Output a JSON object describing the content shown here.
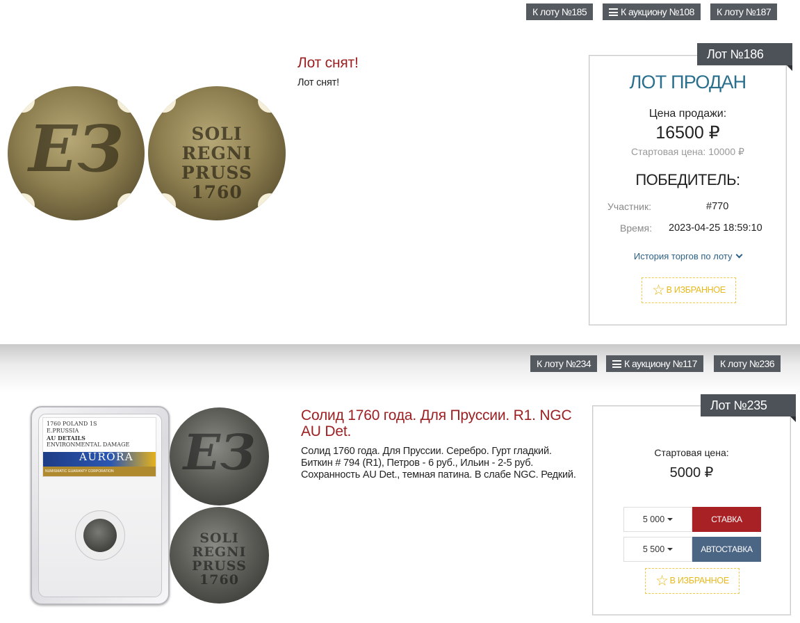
{
  "lot1": {
    "nav": {
      "prev": "К лоту №185",
      "auction": "К аукциону №108",
      "next": "К лоту №187"
    },
    "title": "Лот снят!",
    "description": "Лот снят!",
    "panel": {
      "lot_number": "Лот №186",
      "status": "ЛОТ ПРОДАН",
      "sale_price_label": "Цена продажи:",
      "sale_price": "16500 ₽",
      "start_price": "Стартовая цена: 10000 ₽",
      "winner_heading": "ПОБЕДИТЕЛЬ:",
      "participant_label": "Участник:",
      "participant_value": "#770",
      "time_label": "Время:",
      "time_value": "2023-04-25 18:59:10",
      "history_link": "История торгов по лоту",
      "favorite": "В ИЗБРАННОЕ"
    },
    "coin_obverse": {
      "mono": "ЕЗ"
    },
    "coin_reverse": {
      "lines": [
        "SOLI",
        "REGNI",
        "PRUSS",
        "1760"
      ]
    }
  },
  "lot2": {
    "nav": {
      "prev": "К лоту №234",
      "auction": "К аукциону №117",
      "next": "К лоту №236"
    },
    "title": "Солид 1760 года. Для Пруссии. R1. NGC AU Det.",
    "description": "Солид 1760 года. Для Пруссии. Серебро. Гурт гладкий. Биткин # 794 (R1), Петров - 6 руб., Ильин - 2-5 руб. Сохранность AU Det., темная патина. В слабе NGC. Редкий.",
    "panel": {
      "lot_number": "Лот №235",
      "start_price_label": "Стартовая цена:",
      "start_price": "5000 ₽",
      "bid_amount": "5 000",
      "bid_button": "СТАВКА",
      "autobid_amount": "5 500",
      "autobid_button": "АВТОСТАВКА",
      "favorite": "В ИЗБРАННОЕ"
    },
    "slab": {
      "line1": "1760 POLAND 1S",
      "line2": "E.PRUSSIA",
      "line3": "AU DETAILS",
      "line4": "ENVIRONMENTAL DAMAGE",
      "brand": "AURORA",
      "footer": "NUMISMATIC GUARANTY CORPORATION"
    },
    "coin_reverse": {
      "lines": [
        "SOLI",
        "REGNI",
        "PRUSS",
        "1760"
      ]
    }
  },
  "colors": {
    "title_red": "#9c1f22",
    "nav_dark": "#555a60",
    "bid_red": "#a82124",
    "autobid_blue": "#4b6585",
    "favorite_gold": "#e8b91c",
    "status_blue": "#2b6f8e"
  }
}
